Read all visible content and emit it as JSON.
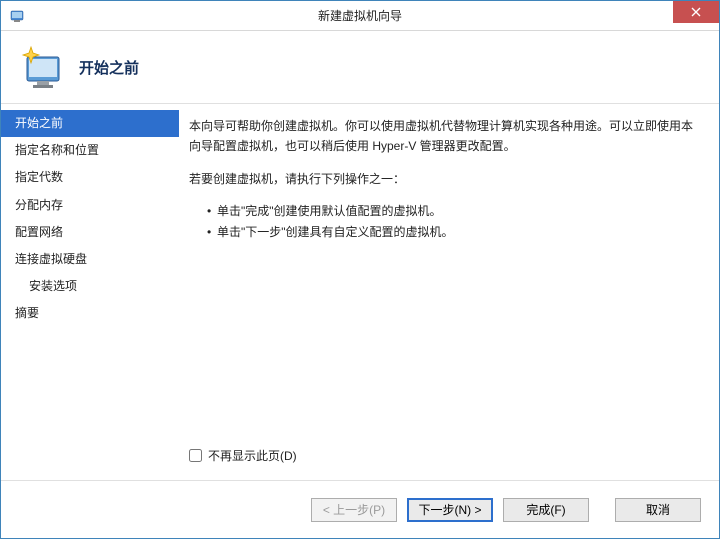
{
  "window": {
    "title": "新建虚拟机向导"
  },
  "header": {
    "title": "开始之前"
  },
  "sidebar": {
    "steps": [
      {
        "label": "开始之前",
        "active": true,
        "indent": false
      },
      {
        "label": "指定名称和位置",
        "active": false,
        "indent": false
      },
      {
        "label": "指定代数",
        "active": false,
        "indent": false
      },
      {
        "label": "分配内存",
        "active": false,
        "indent": false
      },
      {
        "label": "配置网络",
        "active": false,
        "indent": false
      },
      {
        "label": "连接虚拟硬盘",
        "active": false,
        "indent": false
      },
      {
        "label": "安装选项",
        "active": false,
        "indent": true
      },
      {
        "label": "摘要",
        "active": false,
        "indent": false
      }
    ]
  },
  "content": {
    "intro": "本向导可帮助你创建虚拟机。你可以使用虚拟机代替物理计算机实现各种用途。可以立即使用本向导配置虚拟机，也可以稍后使用 Hyper-V 管理器更改配置。",
    "prompt": "若要创建虚拟机，请执行下列操作之一：",
    "bullets": [
      "单击\"完成\"创建使用默认值配置的虚拟机。",
      "单击\"下一步\"创建具有自定义配置的虚拟机。"
    ],
    "checkbox_label": "不再显示此页(D)"
  },
  "footer": {
    "prev": "< 上一步(P)",
    "next": "下一步(N) >",
    "finish": "完成(F)",
    "cancel": "取消"
  }
}
